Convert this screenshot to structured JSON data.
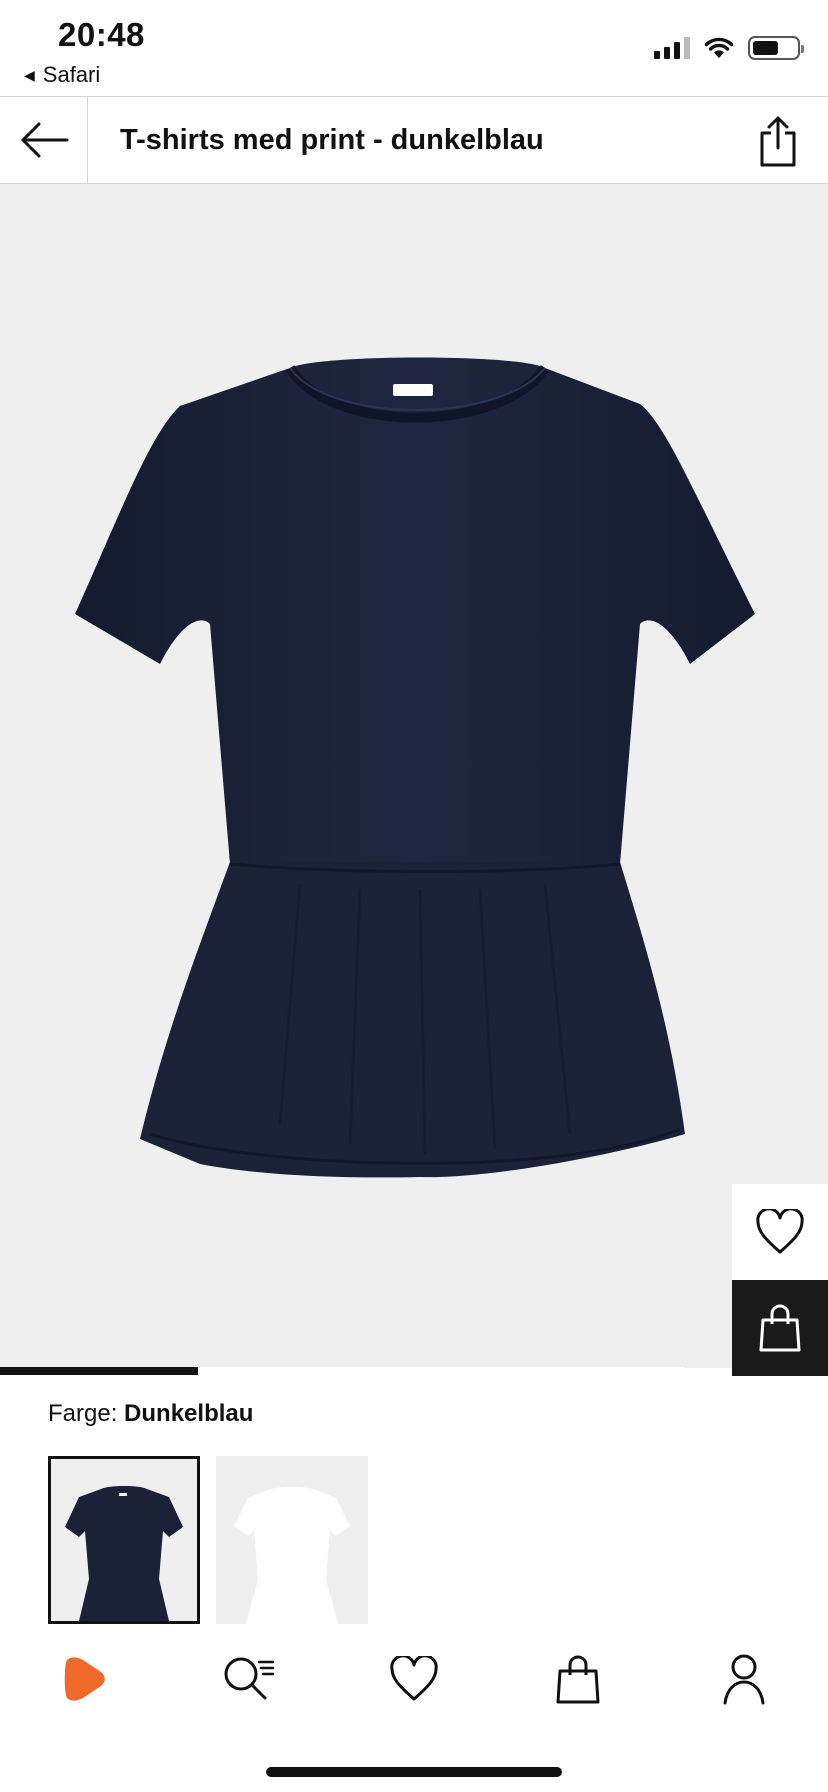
{
  "status_bar": {
    "time": "20:48",
    "back_app": "Safari",
    "battery_level": 0.6
  },
  "header": {
    "title": "T-shirts med print - dunkelblau",
    "back_icon": "arrow-left-icon",
    "share_icon": "share-icon"
  },
  "product": {
    "image_progress": 0.29,
    "wishlist_icon": "heart-icon",
    "add_to_bag_icon": "shopping-bag-icon",
    "shirt_color": "#1b2238",
    "background_color": "#efefef"
  },
  "color": {
    "label": "Farge:",
    "value": "Dunkelblau",
    "swatches": [
      {
        "color": "#1b2238",
        "selected": true
      },
      {
        "color": "#ffffff",
        "selected": false
      }
    ]
  },
  "bottom_nav": {
    "items": [
      {
        "icon": "brand-logo-icon",
        "color": "#ef6a2a"
      },
      {
        "icon": "search-list-icon"
      },
      {
        "icon": "heart-icon"
      },
      {
        "icon": "shopping-bag-icon"
      },
      {
        "icon": "user-icon"
      }
    ]
  }
}
